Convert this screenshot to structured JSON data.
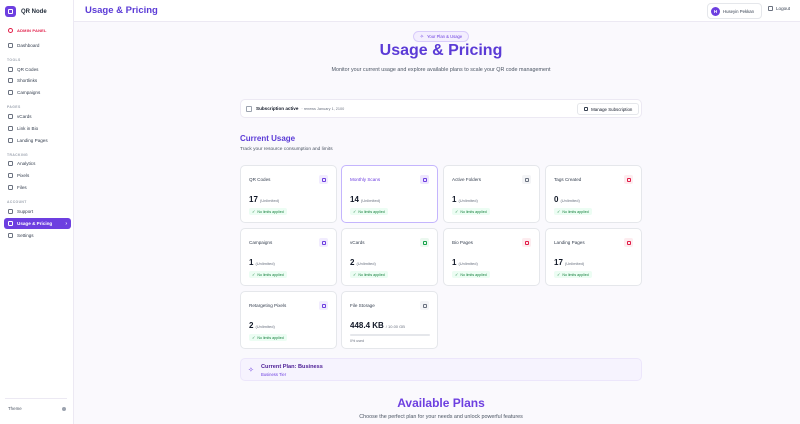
{
  "app": {
    "name": "QR Node"
  },
  "sidebar": {
    "admin_label": "ADMIN PANEL",
    "dashboard": "Dashboard",
    "sections": {
      "tools": "TOOLS",
      "pages": "PAGES",
      "tracking": "TRACKING",
      "account": "ACCOUNT"
    },
    "items": {
      "qr_codes": "QR Codes",
      "shortlinks": "Shortlinks",
      "campaigns": "Campaigns",
      "vcards": "vCards",
      "link_in_bio": "Link in Bio",
      "landing_pages": "Landing Pages",
      "analytics": "Analytics",
      "pixels": "Pixels",
      "files": "Files",
      "support": "Support",
      "usage_pricing": "Usage & Pricing",
      "settings": "Settings"
    },
    "theme_label": "Theme"
  },
  "topbar": {
    "title": "Usage & Pricing",
    "user_initial": "H",
    "user_name": "Huseyin Pekkan",
    "logout": "Logout"
  },
  "hero": {
    "pill": "Your Plan & Usage",
    "title": "Usage & Pricing",
    "subtitle": "Monitor your current usage and explore available plans to scale your QR code management"
  },
  "subscription": {
    "status": "Subscription active",
    "renews": "· renews January 1, 2100",
    "manage_button": "Manage Subscription"
  },
  "current_usage": {
    "title": "Current Usage",
    "subtitle": "Track your resource consumption and limits"
  },
  "cards": [
    {
      "label": "QR Codes",
      "value": "17",
      "unit": "(Unlimited)",
      "badge": "No limits applied",
      "icon_color": "#6d3fe0",
      "icon_bg": "#f1ecfe"
    },
    {
      "label": "Monthly Scans",
      "value": "14",
      "unit": "(Unlimited)",
      "badge": "No limits applied",
      "icon_color": "#6d3fe0",
      "icon_bg": "#ede5fe"
    },
    {
      "label": "Active Folders",
      "value": "1",
      "unit": "(Unlimited)",
      "badge": "No limits applied",
      "icon_color": "#6b7280",
      "icon_bg": "#f3f4f6"
    },
    {
      "label": "Tags Created",
      "value": "0",
      "unit": "(Unlimited)",
      "badge": "No limits applied",
      "icon_color": "#e11d48",
      "icon_bg": "#fdecef"
    },
    {
      "label": "Campaigns",
      "value": "1",
      "unit": "(Unlimited)",
      "badge": "No limits applied",
      "icon_color": "#6d3fe0",
      "icon_bg": "#f1ecfe"
    },
    {
      "label": "vCards",
      "value": "2",
      "unit": "(Unlimited)",
      "badge": "No limits applied",
      "icon_color": "#16a34a",
      "icon_bg": "#ebf8ef"
    },
    {
      "label": "Bio Pages",
      "value": "1",
      "unit": "(Unlimited)",
      "badge": "No limits applied",
      "icon_color": "#e11d48",
      "icon_bg": "#fdecef"
    },
    {
      "label": "Landing Pages",
      "value": "17",
      "unit": "(Unlimited)",
      "badge": "No limits applied",
      "icon_color": "#e11d48",
      "icon_bg": "#fdecef"
    },
    {
      "label": "Retargeting Pixels",
      "value": "2",
      "unit": "(Unlimited)",
      "badge": "No limits applied",
      "icon_color": "#6d3fe0",
      "icon_bg": "#f1ecfe"
    }
  ],
  "storage": {
    "label": "File Storage",
    "value": "448.4 KB",
    "limit": "/ 10.00 GB",
    "used_text": "0% used",
    "used_fraction": 0.0,
    "icon_color": "#6b7280",
    "icon_bg": "#f3f4f6"
  },
  "current_plan": {
    "title": "Current Plan: Business",
    "tier": "Business Tier"
  },
  "available_plans": {
    "title": "Available Plans",
    "subtitle": "Choose the perfect plan for your needs and unlock powerful features"
  },
  "colors": {
    "accent": "#6d3fe0",
    "success": "#15803d",
    "danger": "#e11d48"
  }
}
